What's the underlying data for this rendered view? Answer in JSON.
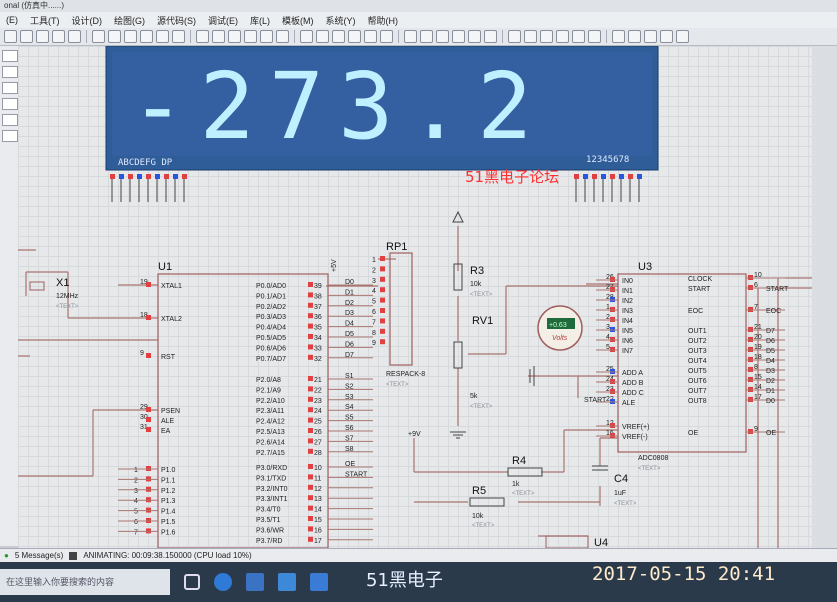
{
  "titlebar": {
    "text": "onal (仿真中......)"
  },
  "menu": [
    "(E)",
    "工具(T)",
    "设计(D)",
    "绘图(G)",
    "源代码(S)",
    "调试(E)",
    "库(L)",
    "模板(M)",
    "系统(Y)",
    "帮助(H)"
  ],
  "lcd": {
    "value": "-273.2",
    "left_caption": "ABCDEFG DP",
    "right_caption": "12345678"
  },
  "forum_text": "51黑电子论坛",
  "u1": {
    "ref": "U1",
    "xtal_left_pins": [
      [
        "19",
        "XTAL1"
      ],
      [
        "18",
        "XTAL2"
      ],
      [
        "9",
        "RST"
      ],
      [
        "29",
        "PSEN"
      ],
      [
        "30",
        "ALE"
      ],
      [
        "31",
        "EA"
      ]
    ],
    "p0": [
      [
        "39",
        "P0.0/AD0"
      ],
      [
        "38",
        "P0.1/AD1"
      ],
      [
        "37",
        "P0.2/AD2"
      ],
      [
        "36",
        "P0.3/AD3"
      ],
      [
        "35",
        "P0.4/AD4"
      ],
      [
        "34",
        "P0.5/AD5"
      ],
      [
        "33",
        "P0.6/AD6"
      ],
      [
        "32",
        "P0.7/AD7"
      ]
    ],
    "p2": [
      [
        "21",
        "P2.0/A8"
      ],
      [
        "22",
        "P2.1/A9"
      ],
      [
        "23",
        "P2.2/A10"
      ],
      [
        "24",
        "P2.3/A11"
      ],
      [
        "25",
        "P2.4/A12"
      ],
      [
        "26",
        "P2.5/A13"
      ],
      [
        "27",
        "P2.6/A14"
      ],
      [
        "28",
        "P2.7/A15"
      ]
    ],
    "p3": [
      [
        "10",
        "P3.0/RXD"
      ],
      [
        "11",
        "P3.1/TXD"
      ],
      [
        "12",
        "P3.2/INT0"
      ],
      [
        "13",
        "P3.3/INT1"
      ],
      [
        "14",
        "P3.4/T0"
      ],
      [
        "15",
        "P3.5/T1"
      ],
      [
        "16",
        "P3.6/WR"
      ],
      [
        "17",
        "P3.7/RD"
      ]
    ],
    "p1": [
      [
        "1",
        "P1.0"
      ],
      [
        "2",
        "P1.1"
      ],
      [
        "3",
        "P1.2"
      ],
      [
        "4",
        "P1.3"
      ],
      [
        "5",
        "P1.4"
      ],
      [
        "6",
        "P1.5"
      ],
      [
        "7",
        "P1.6"
      ]
    ],
    "dnets": [
      "D0",
      "D1",
      "D2",
      "D3",
      "D4",
      "D5",
      "D6",
      "D7"
    ],
    "snets": [
      "S1",
      "S2",
      "S3",
      "S4",
      "S5",
      "S6",
      "S7",
      "S8"
    ],
    "p3nets": [
      "OE",
      "START"
    ]
  },
  "x1": {
    "ref": "X1",
    "freq": "12MHz",
    "text": "<TEXT>"
  },
  "rp1": {
    "ref": "RP1",
    "part": "RESPACK-8",
    "text": "<TEXT>",
    "pins": [
      "1",
      "2",
      "3",
      "4",
      "5",
      "6",
      "7",
      "8",
      "9"
    ]
  },
  "vcc_label": "+5V",
  "r3": {
    "ref": "R3",
    "value": "10k",
    "text": "<TEXT>"
  },
  "rv1": {
    "ref": "RV1",
    "value": "5k",
    "text": "<TEXT>"
  },
  "voltmeter": {
    "reading": "+0.63",
    "unit": "Volts"
  },
  "plus9v": "+9V",
  "r4": {
    "ref": "R4",
    "value": "1k",
    "text": "<TEXT>"
  },
  "r5": {
    "ref": "R5",
    "value": "10k",
    "text": "<TEXT>"
  },
  "c4": {
    "ref": "C4",
    "value": "1uF",
    "text": "<TEXT>"
  },
  "u4": {
    "ref": "U4"
  },
  "u3": {
    "ref": "U3",
    "part": "ADC0808",
    "text": "<TEXT>",
    "left": [
      [
        "26",
        "IN0"
      ],
      [
        "27",
        "IN1"
      ],
      [
        "28",
        "IN2"
      ],
      [
        "1",
        "IN3"
      ],
      [
        "2",
        "IN4"
      ],
      [
        "3",
        "IN5"
      ],
      [
        "4",
        "IN6"
      ],
      [
        "5",
        "IN7"
      ],
      [
        "25",
        "ADD A"
      ],
      [
        "24",
        "ADD B"
      ],
      [
        "23",
        "ADD C"
      ],
      [
        "22",
        "ALE"
      ],
      [
        "12",
        "VREF(+)"
      ],
      [
        "16",
        "VREF(-)"
      ]
    ],
    "right": [
      [
        "10",
        "CLOCK"
      ],
      [
        "6",
        "START"
      ],
      [
        "7",
        "EOC"
      ],
      [
        "21",
        "OUT1"
      ],
      [
        "20",
        "OUT2"
      ],
      [
        "19",
        "OUT3"
      ],
      [
        "18",
        "OUT4"
      ],
      [
        "8",
        "OUT5"
      ],
      [
        "15",
        "OUT6"
      ],
      [
        "14",
        "OUT7"
      ],
      [
        "17",
        "OUT8"
      ],
      [
        "9",
        "OE"
      ]
    ],
    "start_net": "START",
    "right_nets": [
      "START",
      "EOC",
      "D7",
      "D6",
      "D5",
      "D4",
      "D3",
      "D2",
      "D1",
      "D0",
      "OE"
    ]
  },
  "status": {
    "messages": "5 Message(s)",
    "animating": "ANIMATING: 00:09:38.150000 (CPU load 10%)"
  },
  "taskbar": {
    "search": "在这里输入你要搜索的内容"
  },
  "watermark": "51黑电子",
  "timestamp": "2017-05-15  20:41",
  "colors": {
    "lcd_bg": "#2f5d98",
    "lcd_digit": "#bff0ff",
    "wire": "#a9756f",
    "canvas": "#e6e8ea"
  }
}
